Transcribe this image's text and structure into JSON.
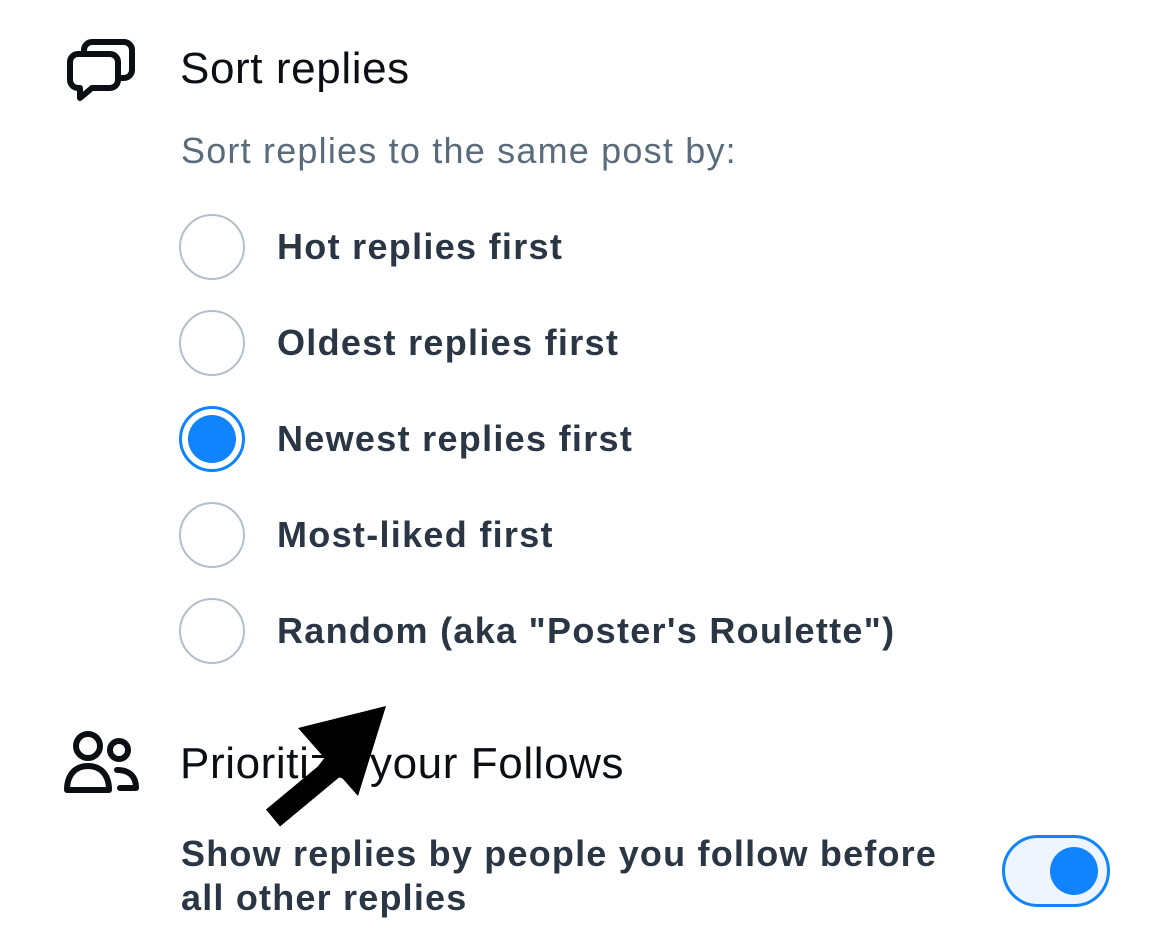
{
  "sort_section": {
    "icon": "chat-bubbles-icon",
    "title": "Sort replies",
    "subtitle": "Sort replies to the same post by:",
    "options": [
      {
        "label": "Hot replies first",
        "selected": false
      },
      {
        "label": "Oldest replies first",
        "selected": false
      },
      {
        "label": "Newest replies first",
        "selected": true
      },
      {
        "label": "Most-liked first",
        "selected": false
      },
      {
        "label": "Random (aka \"Poster's Roulette\")",
        "selected": false
      }
    ]
  },
  "follows_section": {
    "icon": "people-icon",
    "title": "Prioritize your Follows",
    "setting_label": "Show replies by people you follow before all other replies",
    "toggle_on": true
  },
  "overlay": {
    "icon": "arrow-icon"
  },
  "colors": {
    "accent": "#1083fe",
    "radio_border": "#b3bfca",
    "subtitle_text": "#5a6b7c",
    "body_text": "#2a3644"
  }
}
